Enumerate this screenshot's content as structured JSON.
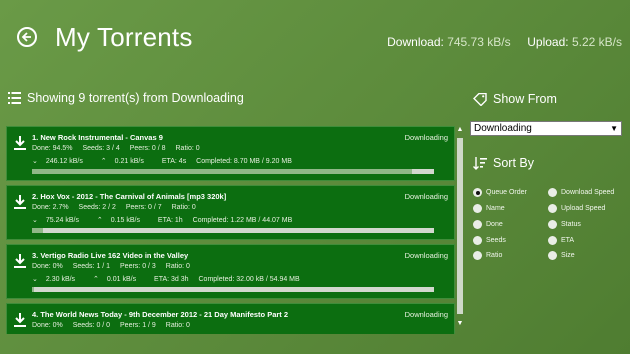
{
  "header": {
    "title": "My Torrents",
    "download_label": "Download:",
    "download_value": "745.73 kB/s",
    "upload_label": "Upload:",
    "upload_value": "5.22 kB/s"
  },
  "list": {
    "heading": "Showing 9 torrent(s) from Downloading"
  },
  "torrents": [
    {
      "name": "1.  New Rock Instrumental - Canvas 9",
      "status": "Downloading",
      "done": "Done: 94.5%",
      "seeds": "Seeds: 3 / 4",
      "peers": "Peers: 0 / 8",
      "ratio": "Ratio: 0",
      "down": "246.12 kB/s",
      "up": "0.21 kB/s",
      "eta": "ETA: 4s",
      "completed": "Completed: 8.70 MB / 9.20 MB",
      "progress": 0.945
    },
    {
      "name": "2.  Hox Vox - 2012 - The Carnival of Animals [mp3 320k]",
      "status": "Downloading",
      "done": "Done: 2.7%",
      "seeds": "Seeds: 2 / 2",
      "peers": "Peers: 0 / 7",
      "ratio": "Ratio: 0",
      "down": "75.24 kB/s",
      "up": "0.15 kB/s",
      "eta": "ETA: 1h",
      "completed": "Completed: 1.22 MB / 44.07 MB",
      "progress": 0.027
    },
    {
      "name": "3.  Vertigo Radio Live 162 Video in the Valley",
      "status": "Downloading",
      "done": "Done: 0%",
      "seeds": "Seeds: 1 / 1",
      "peers": "Peers: 0 / 3",
      "ratio": "Ratio: 0",
      "down": "2.30 kB/s",
      "up": "0.01 kB/s",
      "eta": "ETA: 3d 3h",
      "completed": "Completed: 32.00 kB / 54.94 MB",
      "progress": 0.0
    },
    {
      "name": "4.  The World News Today - 9th December 2012 - 21 Day Manifesto Part 2",
      "status": "Downloading",
      "done": "Done: 0%",
      "seeds": "Seeds: 0 / 0",
      "peers": "Peers: 1 / 9",
      "ratio": "Ratio: 0",
      "down": "",
      "up": "",
      "eta": "",
      "completed": "",
      "progress": 0.0
    }
  ],
  "filter": {
    "heading": "Show From",
    "selected": "Downloading"
  },
  "sort": {
    "heading": "Sort By",
    "selected": "Queue Order",
    "options": [
      "Queue Order",
      "Name",
      "Done",
      "Seeds",
      "Ratio",
      "Download Speed",
      "Upload Speed",
      "Status",
      "ETA",
      "Size"
    ]
  },
  "colors": {
    "item_bg": "#0c6e10",
    "progress_fill": "#90b888",
    "progress_track": "#d2d8ce"
  }
}
